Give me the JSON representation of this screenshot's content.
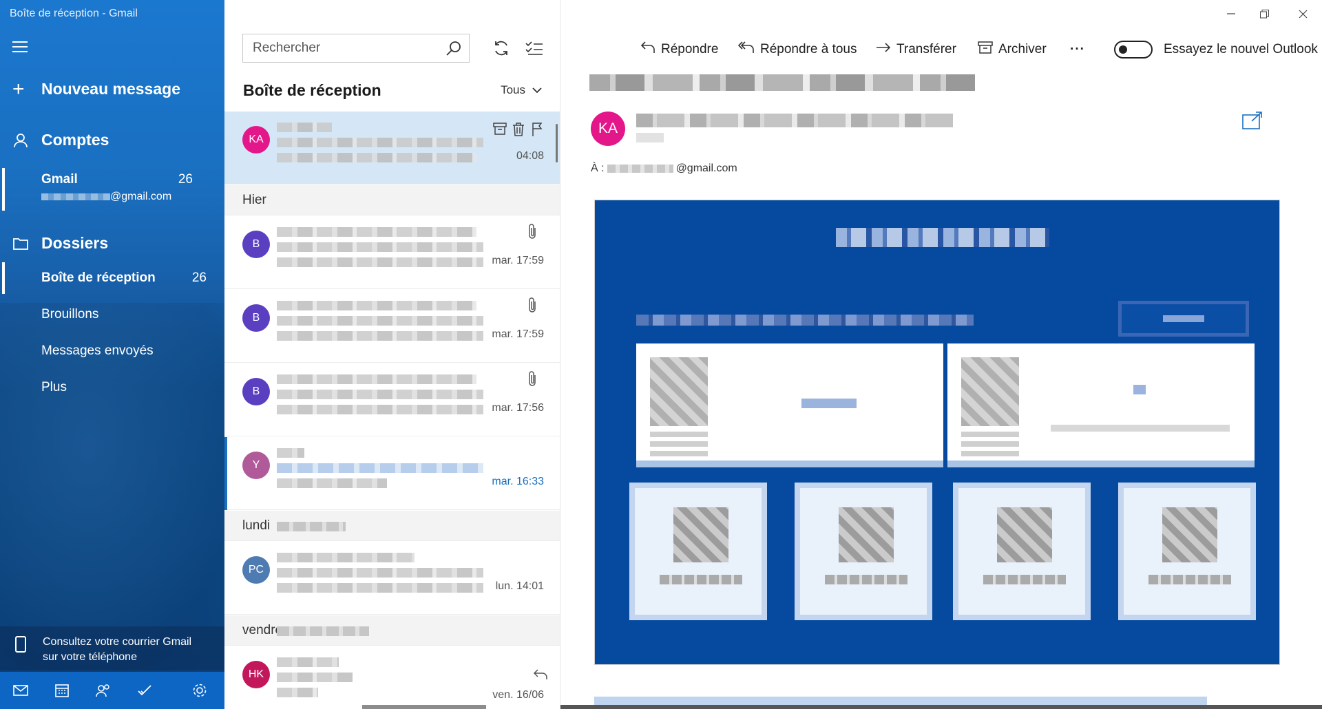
{
  "app": {
    "title": "Boîte de réception - Gmail"
  },
  "nav": {
    "new_message": "Nouveau message",
    "accounts_heading": "Comptes",
    "account": {
      "name": "Gmail",
      "count": "26",
      "email_suffix": "@gmail.com"
    },
    "folders_heading": "Dossiers",
    "folders": [
      {
        "label": "Boîte de réception",
        "count": "26",
        "active": true
      },
      {
        "label": "Brouillons",
        "count": ""
      },
      {
        "label": "Messages envoyés",
        "count": ""
      },
      {
        "label": "Plus",
        "count": ""
      }
    ],
    "phone_promo": "Consultez votre courrier Gmail sur votre téléphone",
    "bottom_icons": [
      "mail-icon",
      "calendar-icon",
      "people-icon",
      "todo-icon",
      "settings-icon"
    ]
  },
  "list": {
    "search_placeholder": "Rechercher",
    "title": "Boîte de réception",
    "filter": "Tous",
    "items": [
      {
        "initials": "KA",
        "color": "#e3168a",
        "time": "04:08",
        "selected": true
      },
      {
        "separator": "Hier"
      },
      {
        "initials": "B",
        "color": "#5a3fc1",
        "time": "mar. 17:59",
        "attachment": true
      },
      {
        "initials": "B",
        "color": "#5a3fc1",
        "time": "mar. 17:59",
        "attachment": true
      },
      {
        "initials": "B",
        "color": "#5a3fc1",
        "time": "mar. 17:56",
        "attachment": true
      },
      {
        "initials": "Y",
        "color": "#b05a9a",
        "time": "mar. 16:33",
        "unread": true
      },
      {
        "separator": "lundi"
      },
      {
        "initials": "PC",
        "color": "#4f7bb3",
        "time": "lun. 14:01"
      },
      {
        "separator": "vendre"
      },
      {
        "initials": "HK",
        "color": "#c2185b",
        "time": "ven. 16/06",
        "replied": true
      }
    ]
  },
  "reader": {
    "toolbar": {
      "reply": "Répondre",
      "reply_all": "Répondre à tous",
      "forward": "Transférer",
      "archive": "Archiver",
      "more": "···",
      "outlook_toggle": "Essayez le nouvel Outlook"
    },
    "sender_initials": "KA",
    "to_label": "À :",
    "to_suffix": "@gmail.com"
  }
}
